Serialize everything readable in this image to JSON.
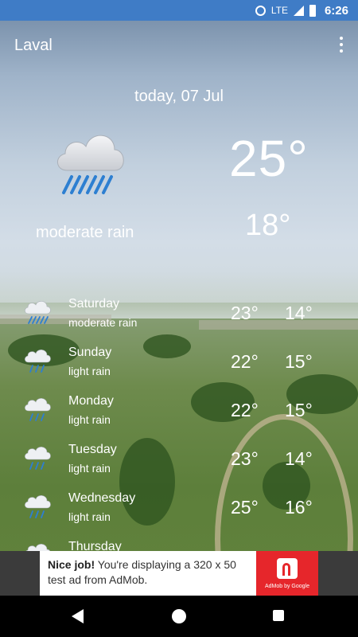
{
  "status_bar": {
    "time": "6:26",
    "network": "LTE"
  },
  "header": {
    "city": "Laval"
  },
  "today": {
    "date": "today, 07 Jul",
    "high": "25°",
    "low": "18°",
    "condition": "moderate rain",
    "icon": "cloud-rain-icon"
  },
  "forecast": [
    {
      "day": "Saturday",
      "condition": "moderate rain",
      "high": "23°",
      "low": "14°"
    },
    {
      "day": "Sunday",
      "condition": "light rain",
      "high": "22°",
      "low": "15°"
    },
    {
      "day": "Monday",
      "condition": "light rain",
      "high": "22°",
      "low": "15°"
    },
    {
      "day": "Tuesday",
      "condition": "light rain",
      "high": "23°",
      "low": "14°"
    },
    {
      "day": "Wednesday",
      "condition": "light rain",
      "high": "25°",
      "low": "16°"
    },
    {
      "day": "Thursday",
      "condition": "",
      "high": "",
      "low": ""
    }
  ],
  "ad": {
    "headline": "Nice job!",
    "body": " You're displaying a 320 x 50 test ad from AdMob.",
    "brand": "AdMob by Google"
  },
  "colors": {
    "status_bar": "#3f7cc6",
    "ad_logo": "#e6262b"
  }
}
